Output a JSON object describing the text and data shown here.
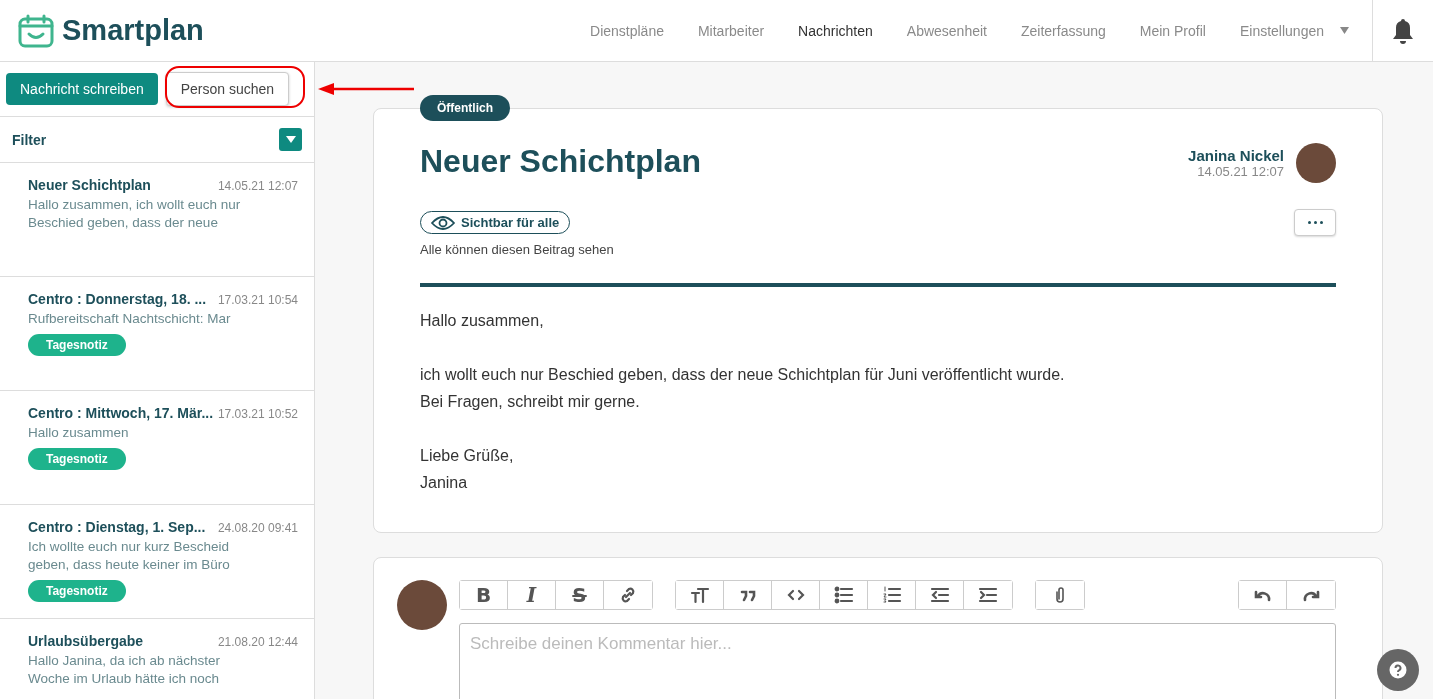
{
  "header": {
    "logo": "Smartplan",
    "nav": [
      {
        "label": "Dienstpläne",
        "selected": false
      },
      {
        "label": "Mitarbeiter",
        "selected": false
      },
      {
        "label": "Nachrichten",
        "selected": true
      },
      {
        "label": "Abwesenheit",
        "selected": false
      },
      {
        "label": "Zeiterfassung",
        "selected": false
      },
      {
        "label": "Mein Profil",
        "selected": false
      },
      {
        "label": "Einstellungen",
        "selected": false,
        "dropdown": true
      }
    ]
  },
  "sidebar": {
    "buttons": [
      {
        "label": "Nachricht schreiben",
        "kind": "primary"
      },
      {
        "label": "Person suchen",
        "kind": "secondary"
      }
    ],
    "filter": "Filter",
    "messages": [
      {
        "title": "Neuer Schichtplan",
        "time": "14.05.21 12:07",
        "preview": "Hallo zusammen, ich wollt euch nur Beschied geben, dass der neue"
      },
      {
        "title": "Centro : Donnerstag, 18. ...",
        "time": "17.03.21 10:54",
        "preview": "Rufbereitschaft Nachtschicht: Mar",
        "tag": "Tagesnotiz"
      },
      {
        "title": "Centro : Mittwoch, 17. Mär...",
        "time": "17.03.21 10:52",
        "preview": "Hallo zusammen",
        "tag": "Tagesnotiz"
      },
      {
        "title": "Centro : Dienstag, 1. Sep...",
        "time": "24.08.20 09:41",
        "preview": "Ich wollte euch nur kurz Bescheid geben, dass heute keiner im Büro",
        "tag": "Tagesnotiz"
      },
      {
        "title": "Urlaubsübergabe",
        "time": "21.08.20 12:44",
        "preview": "Hallo Janina, da ich ab nächster Woche im Urlaub hätte ich noch"
      }
    ]
  },
  "post": {
    "badge": "Öffentlich",
    "title": "Neuer Schichtplan",
    "author": "Janina Nickel",
    "time": "14.05.21 12:07",
    "visibility": "Sichtbar für alle",
    "visibility_note": "Alle können diesen Beitrag sehen",
    "paragraphs": [
      [
        "Hallo zusammen,"
      ],
      [
        "ich wollt euch nur Beschied geben, dass der neue Schichtplan für Juni veröffentlicht wurde.",
        "Bei Fragen, schreibt mir gerne."
      ],
      [
        "Liebe Grüße,",
        "Janina"
      ]
    ]
  },
  "comment": {
    "toolbar": [
      [
        {
          "kind": "bold",
          "glyph": "B"
        },
        {
          "kind": "italic",
          "glyph": "I"
        },
        {
          "kind": "strike",
          "glyph": "S"
        },
        {
          "kind": "link"
        }
      ],
      [
        {
          "kind": "heading"
        },
        {
          "kind": "quote"
        },
        {
          "kind": "code"
        },
        {
          "kind": "bullets"
        },
        {
          "kind": "numbers"
        },
        {
          "kind": "outdent"
        },
        {
          "kind": "indent"
        }
      ],
      [
        {
          "kind": "attach"
        }
      ]
    ],
    "history": [
      {
        "kind": "undo"
      },
      {
        "kind": "redo"
      }
    ],
    "placeholder": "Schreibe deinen Kommentar hier..."
  }
}
